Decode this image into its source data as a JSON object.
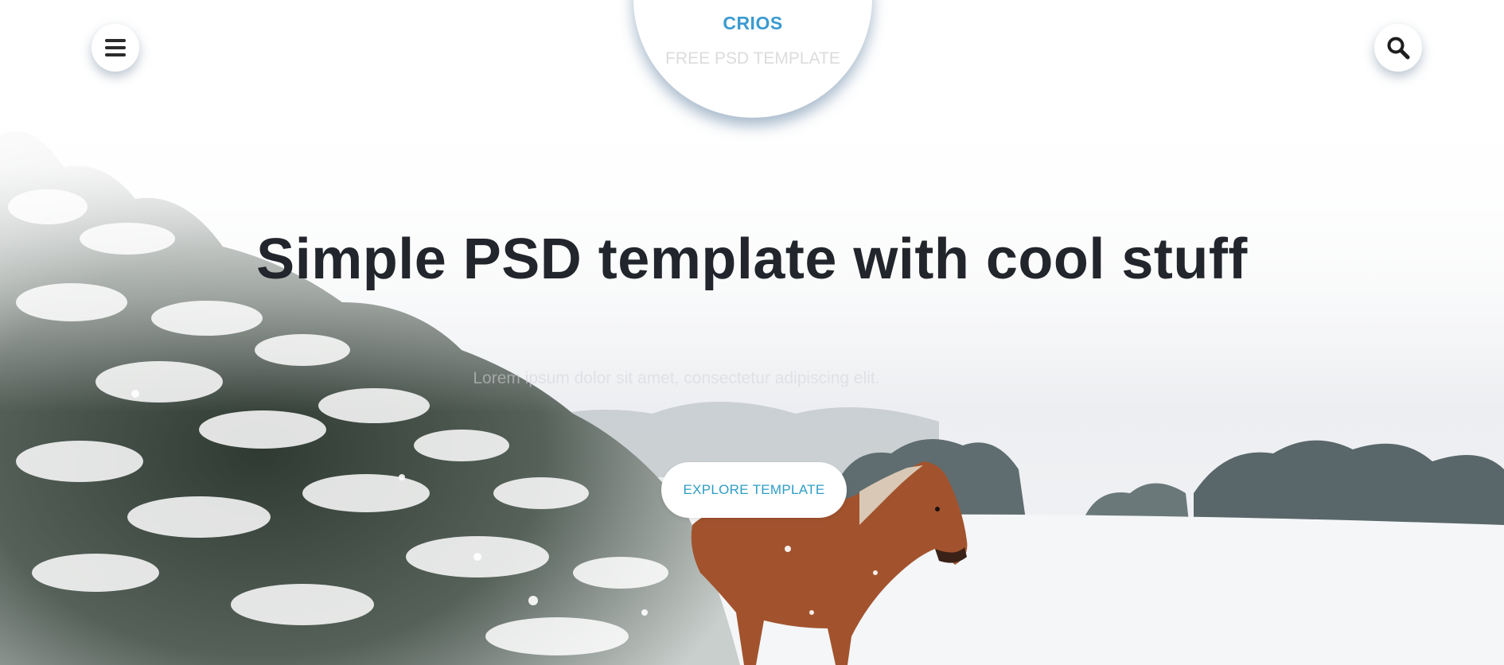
{
  "brand": {
    "name": "CRIOS",
    "subtitle": "FREE PSD TEMPLATE"
  },
  "header": {
    "menu_icon": "hamburger-menu-icon",
    "search_icon": "search-icon"
  },
  "hero": {
    "headline": "Simple PSD template with cool stuff",
    "tagline": "Lorem ipsum dolor sit amet, consectetur adipiscing elit.",
    "cta_label": "EXPLORE TEMPLATE",
    "background": "snowy landscape with horse"
  },
  "colors": {
    "accent": "#3a9bd0",
    "cta_text": "#2e9dc4",
    "headline": "#22252b",
    "subtitle": "#dcdcdc"
  }
}
